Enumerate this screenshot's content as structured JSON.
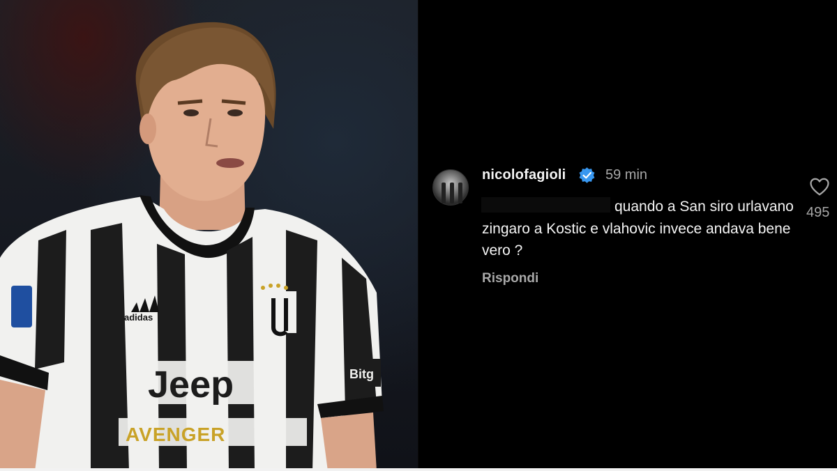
{
  "photo": {
    "jersey_sponsor": "Jeep",
    "jersey_sleeve_sponsor": "Bitg",
    "jersey_brand": "adidas",
    "jersey_secondary_sponsor": "AVENGER"
  },
  "comment": {
    "username": "nicolofagioli",
    "verified_icon": "verified-badge-icon",
    "time": "59 min",
    "text": "quando a San siro urlavano zingaro a Kostic e vlahovic invece andava bene vero ?",
    "reply_label": "Rispondi",
    "like_icon": "heart-outline-icon",
    "likes": "495"
  },
  "colors": {
    "background": "#000000",
    "text_primary": "#f5f5f5",
    "text_secondary": "#a8a8a8",
    "verified_blue": "#3897f0"
  }
}
